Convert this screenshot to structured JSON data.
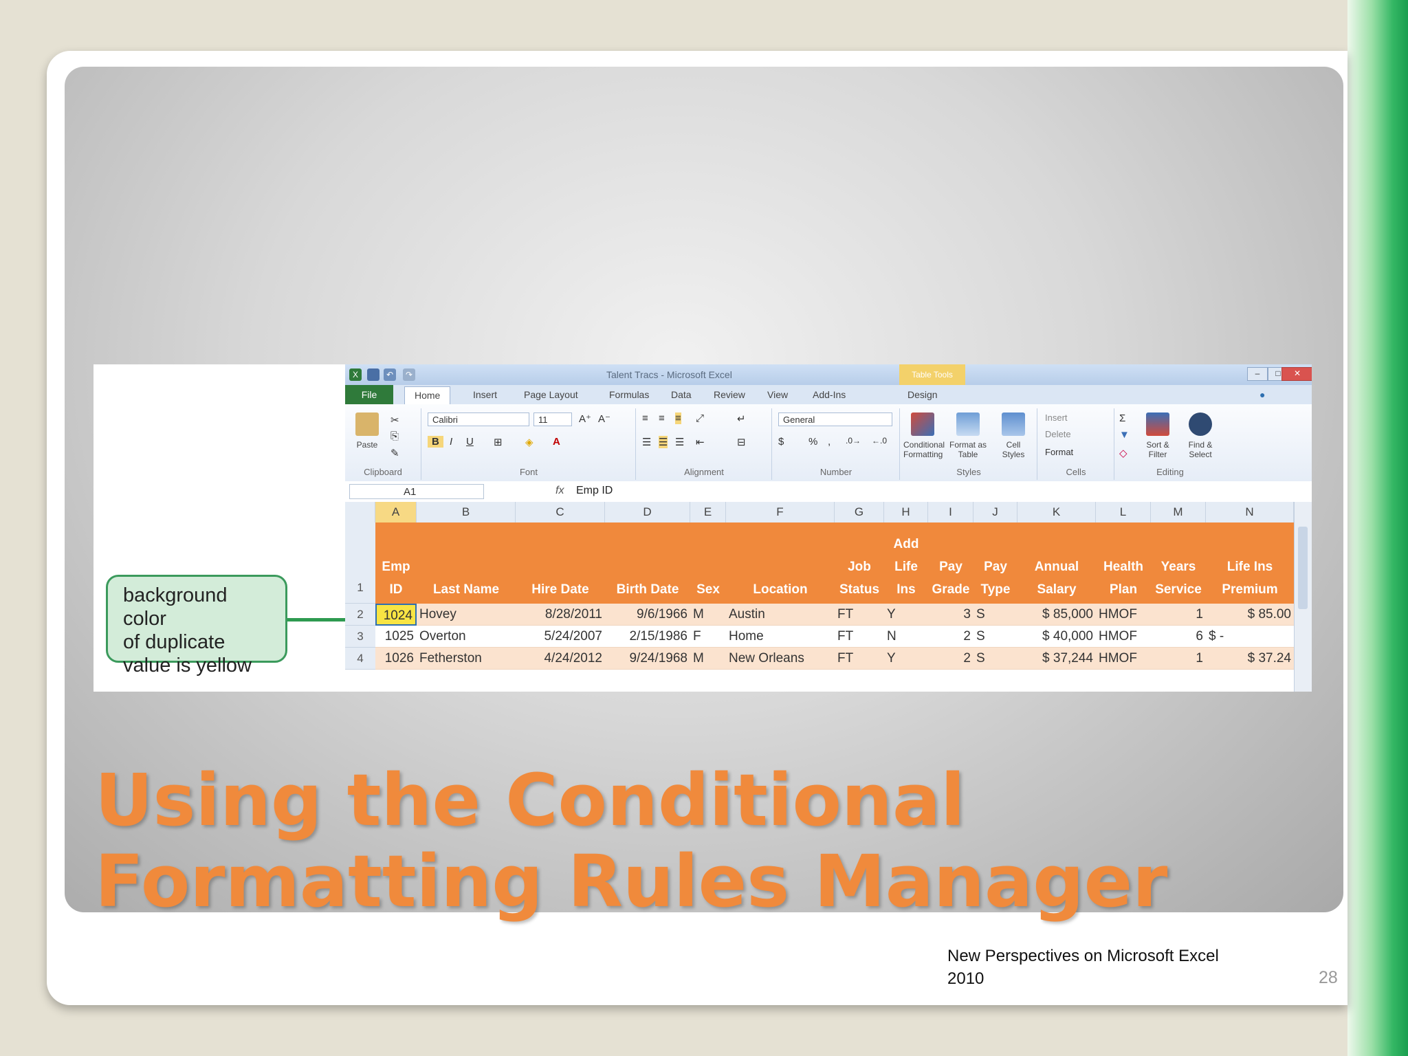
{
  "callout": {
    "line1": "background color",
    "line2": "of duplicate",
    "line3": "value is yellow"
  },
  "excel": {
    "window_title": "Talent Tracs - Microsoft Excel",
    "table_tools": "Table Tools",
    "tabs": [
      "File",
      "Home",
      "Insert",
      "Page Layout",
      "Formulas",
      "Data",
      "Review",
      "View",
      "Add-Ins",
      "Design"
    ],
    "ribbon": {
      "paste": "Paste",
      "clipboard": "Clipboard",
      "font_name": "Calibri",
      "font_size": "11",
      "font": "Font",
      "alignment": "Alignment",
      "number_format": "General",
      "number": "Number",
      "conditional_formatting": "Conditional Formatting",
      "format_as_table": "Format as Table",
      "cell_styles": "Cell Styles",
      "styles": "Styles",
      "insert": "Insert",
      "delete": "Delete",
      "format": "Format",
      "cells": "Cells",
      "sort_filter": "Sort & Filter",
      "find_select": "Find & Select",
      "editing": "Editing"
    },
    "name_box": "A1",
    "formula": "Emp ID",
    "columns": [
      "A",
      "B",
      "C",
      "D",
      "E",
      "F",
      "G",
      "H",
      "I",
      "J",
      "K",
      "L",
      "M",
      "N"
    ],
    "headers": [
      "Emp\nID",
      "Last Name",
      "Hire Date",
      "Birth Date",
      "Sex",
      "Location",
      "Job\nStatus",
      "Add\nLife\nIns",
      "Pay\nGrade",
      "Pay\nType",
      "Annual\nSalary",
      "Health\nPlan",
      "Years\nService",
      "Life Ins\nPremium"
    ],
    "row_numbers": [
      "1",
      "2",
      "3",
      "4"
    ],
    "rows": [
      [
        "1024",
        "Hovey",
        "8/28/2011",
        "9/6/1966",
        "M",
        "Austin",
        "FT",
        "Y",
        "3",
        "S",
        "$ 85,000",
        "HMOF",
        "1",
        "$ 85.00"
      ],
      [
        "1025",
        "Overton",
        "5/24/2007",
        "2/15/1986",
        "F",
        "Home",
        "FT",
        "N",
        "2",
        "S",
        "$ 40,000",
        "HMOF",
        "6",
        "$ -"
      ],
      [
        "1026",
        "Fetherston",
        "4/24/2012",
        "9/24/1968",
        "M",
        "New Orleans",
        "FT",
        "Y",
        "2",
        "S",
        "$ 37,244",
        "HMOF",
        "1",
        "$ 37.24"
      ]
    ]
  },
  "slide": {
    "title_line1": "Using the Conditional",
    "title_line2": "Formatting Rules Manager",
    "footer_line1": "New Perspectives on Microsoft Excel",
    "footer_line2": "2010",
    "page_number": "28"
  },
  "colors": {
    "title": "#f08a3c",
    "header_fill": "#f0893c",
    "duplicate_fill": "#f8e443",
    "callout_fill": "#d3ecd9",
    "accent_green": "#2e9a50"
  }
}
